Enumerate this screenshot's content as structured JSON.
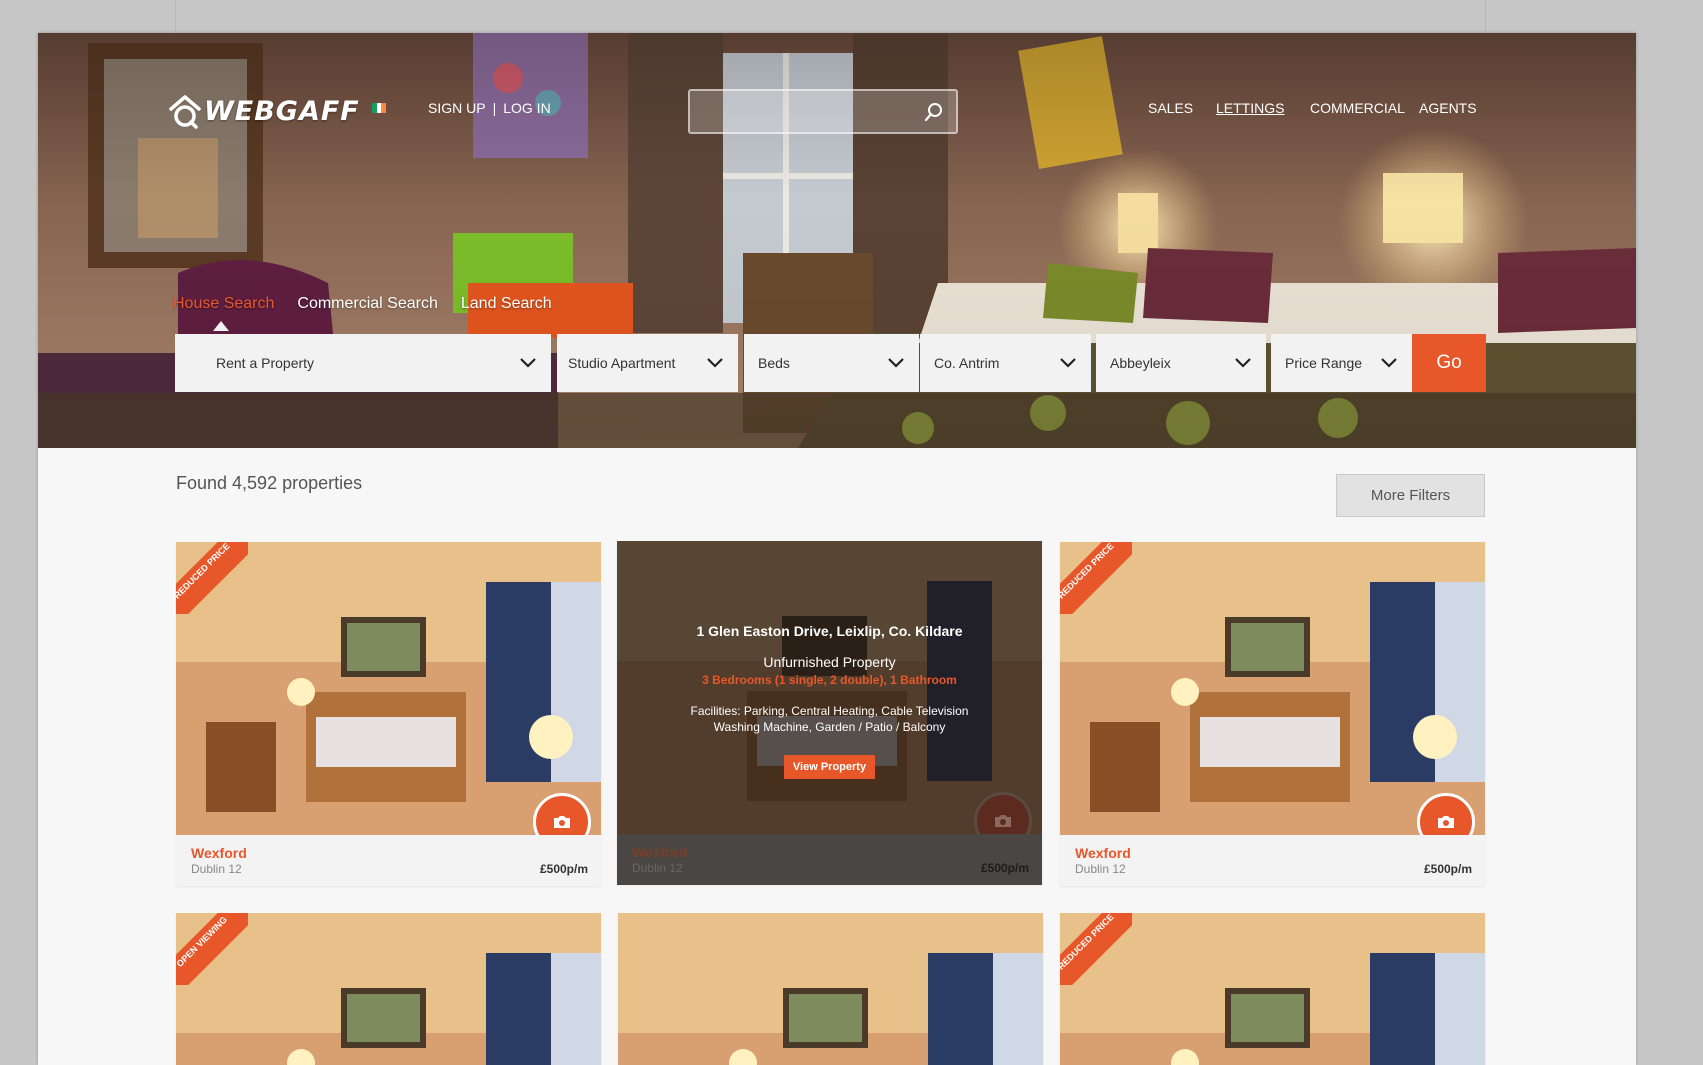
{
  "brand": {
    "logo_text": "WEBGAFF",
    "accent": "#e8572a"
  },
  "auth": {
    "signup": "SIGN UP",
    "separator": "|",
    "login": "LOG IN"
  },
  "search": {
    "placeholder": ""
  },
  "nav": {
    "items": [
      {
        "label": "SALES",
        "active": false
      },
      {
        "label": "LETTINGS",
        "active": true
      },
      {
        "label": "COMMERCIAL",
        "active": false
      },
      {
        "label": "AGENTS",
        "active": false
      }
    ]
  },
  "tabs": [
    {
      "label": "House Search",
      "active": true
    },
    {
      "label": "Commercial Search",
      "active": false
    },
    {
      "label": "Land Search",
      "active": false
    }
  ],
  "filters": {
    "listing_type": "Rent a Property",
    "property_type": "Studio Apartment",
    "beds": "Beds",
    "county": "Co. Antrim",
    "town": "Abbeyleix",
    "price": "Price Range",
    "go_label": "Go"
  },
  "results": {
    "found_text": "Found 4,592 properties",
    "more_filters_label": "More Filters"
  },
  "cards": [
    {
      "city": "Wexford",
      "area": "Dublin 12",
      "price": "£500p/m",
      "ribbon": "REDUCED PRICE"
    },
    {
      "city": "Wexford",
      "area": "Dublin 12",
      "price": "£500p/m",
      "ribbon": "",
      "hover": {
        "address": "1 Glen Easton Drive, Leixlip, Co. Kildare",
        "type": "Unfurnished Property",
        "rooms": "3 Bedrooms (1 single, 2 double), 1 Bathroom",
        "facilities": "Facilities: Parking, Central Heating, Cable Television Washing Machine, Garden / Patio / Balcony",
        "view_label": "View Property"
      }
    },
    {
      "city": "Wexford",
      "area": "Dublin 12",
      "price": "£500p/m",
      "ribbon": "REDUCED PRICE"
    },
    {
      "ribbon": "OPEN VIEWING"
    },
    {
      "ribbon": ""
    },
    {
      "ribbon": "REDUCED PRICE"
    }
  ]
}
